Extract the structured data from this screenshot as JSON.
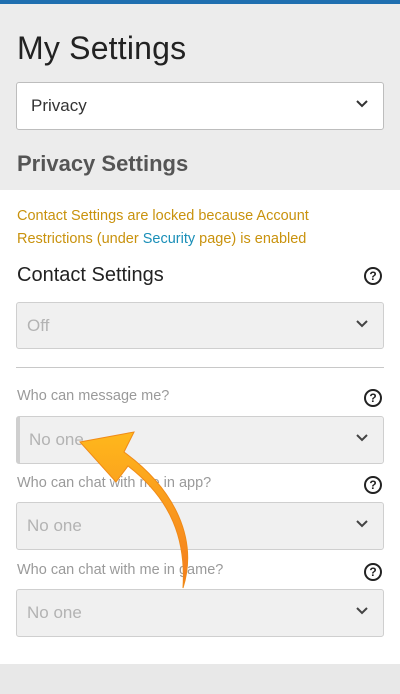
{
  "page": {
    "title": "My Settings"
  },
  "category_select": {
    "selected": "Privacy"
  },
  "section": {
    "heading": "Privacy Settings"
  },
  "warning": {
    "part1": "Contact Settings are locked because Account Restrictions (under ",
    "link": "Security",
    "part2": " page) is enabled"
  },
  "contact_settings": {
    "label": "Contact Settings",
    "selected": "Off",
    "help": "?"
  },
  "message": {
    "label": "Who can message me?",
    "selected": "No one",
    "help": "?"
  },
  "chat_app": {
    "label": "Who can chat with me in app?",
    "selected": "No one",
    "help": "?"
  },
  "chat_game": {
    "label": "Who can chat with me in game?",
    "selected": "No one",
    "help": "?"
  },
  "colors": {
    "accent": "#1a8fd6",
    "warning": "#c9920d",
    "link": "#1a8fb8",
    "arrow": "#f7931e"
  },
  "icons": [
    "chevron-down-icon",
    "help-circle-icon",
    "annotation-arrow-icon"
  ]
}
